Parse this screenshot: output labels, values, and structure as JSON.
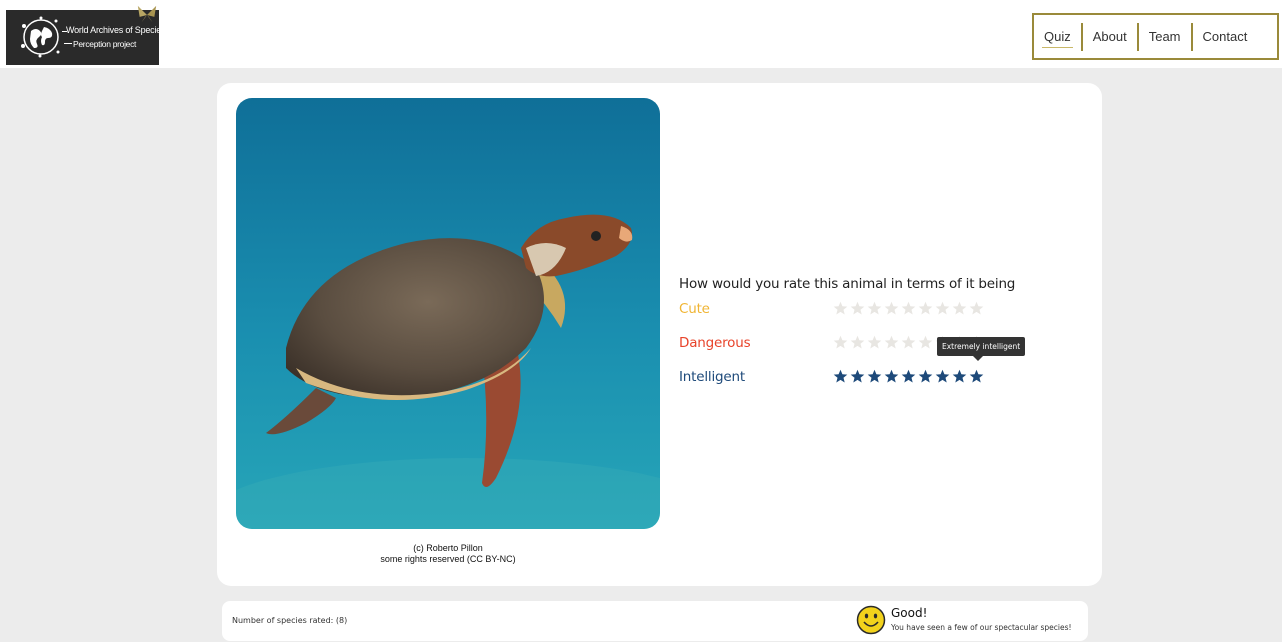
{
  "logo": {
    "line1": "World Archives of Species",
    "line2": "Perception project"
  },
  "nav": {
    "items": [
      {
        "label": "Quiz"
      },
      {
        "label": "About"
      },
      {
        "label": "Team"
      },
      {
        "label": "Contact"
      }
    ],
    "active": "Quiz"
  },
  "photo": {
    "caption_line1": "(c) Roberto Pillon",
    "caption_line2": "some rights reserved (CC BY-NC)"
  },
  "quiz": {
    "question": "How would you rate this animal in terms of it being",
    "max_stars": 9,
    "ratings": [
      {
        "label": "Cute",
        "color": "#f0b534",
        "value": 0
      },
      {
        "label": "Dangerous",
        "color": "#e8432a",
        "value": 0
      },
      {
        "label": "Intelligent",
        "color": "#1e4a7a",
        "value": 9
      }
    ],
    "tooltip": "Extremely intelligent",
    "empty_star_color": "#e8e6e2"
  },
  "footer": {
    "count_text": "Number of species rated: (8)",
    "status_title": "Good!",
    "status_text": "You have seen a few of our spectacular species!"
  },
  "icons": {
    "smiley": "smiley-face-icon",
    "star": "star-icon"
  }
}
